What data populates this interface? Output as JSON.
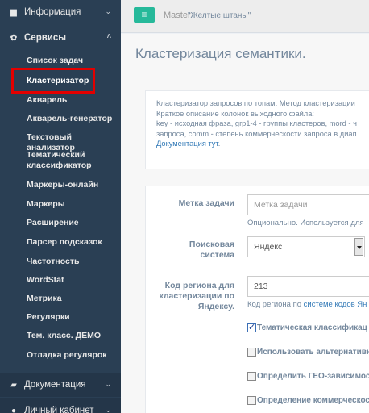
{
  "sidebar": {
    "info": {
      "label": "Информация",
      "icon": "briefcase-icon"
    },
    "services": {
      "label": "Сервисы",
      "icon": "cogs-icon"
    },
    "items": [
      {
        "label": "Список задач"
      },
      {
        "label": "Кластеризатор"
      },
      {
        "label": "Акварель"
      },
      {
        "label": "Акварель-генератор"
      },
      {
        "label": "Текстовый анализатор"
      },
      {
        "label": "Тематический классификатор"
      },
      {
        "label": "Маркеры-онлайн"
      },
      {
        "label": "Маркеры"
      },
      {
        "label": "Расширение"
      },
      {
        "label": "Парсер подсказок"
      },
      {
        "label": "Частотность"
      },
      {
        "label": "WordStat"
      },
      {
        "label": "Метрика"
      },
      {
        "label": "Регулярки"
      },
      {
        "label": "Тем. класс. ДЕМО"
      },
      {
        "label": "Отладка регулярок"
      }
    ],
    "docs": {
      "label": "Документация",
      "icon": "book-icon"
    },
    "cabinet": {
      "label": "Личный кабинет",
      "icon": "user-icon"
    }
  },
  "topbar": {
    "menu_icon": "≡",
    "crumb_root": "Master",
    "crumb_project": "\"Желтые штаны\""
  },
  "page": {
    "title": "Кластеризация семантики.",
    "description": {
      "line1": "Кластеризатор запросов по топам. Метод кластеризации",
      "line2": "Краткое описание колонок выходного файла:",
      "line3": "key - исходная фраза, grp1-4 - группы кластеров, mord - ч",
      "line4": "запроса, comm - степень коммерческости запроса в диап",
      "link": "Документация тут",
      "link_suffix": "."
    }
  },
  "form": {
    "task_label": {
      "label": "Метка задачи",
      "placeholder": "Метка задачи",
      "help": "Опционально. Используется для"
    },
    "engine": {
      "label_line1": "Поисковая",
      "label_line2": "система",
      "value": "Яндекс"
    },
    "region": {
      "label_line1": "Код региона для",
      "label_line2": "кластеризации по",
      "label_line3": "Яндексу.",
      "value": "213",
      "help_prefix": "Код региона по ",
      "help_link": "системе кодов Ян"
    },
    "checkboxes": [
      {
        "label": "Тематическая классификац",
        "checked": true
      },
      {
        "label": "Использовать альтернативн",
        "checked": false
      },
      {
        "label": "Определить ГЕО-зависимост",
        "checked": false
      },
      {
        "label": "Определение коммерческос",
        "checked": false
      }
    ]
  },
  "colors": {
    "sidebar_bg": "#2a3f54",
    "accent": "#26b99a",
    "highlight_box": "#e30000",
    "link": "#337ab7"
  }
}
